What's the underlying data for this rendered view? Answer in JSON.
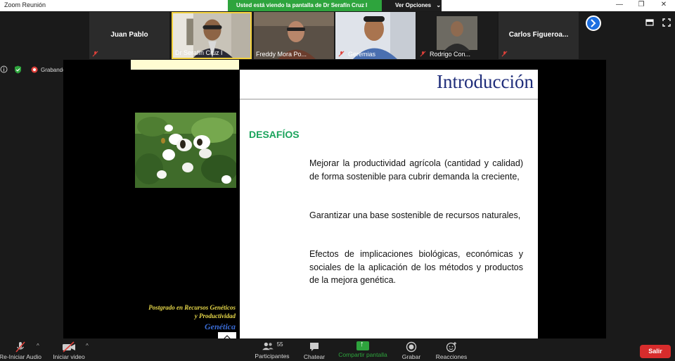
{
  "window": {
    "title": "Zoom Reunión",
    "minimize": "—",
    "restore": "❐",
    "close": "✕"
  },
  "share_banner": {
    "text": "Usted está viendo la pantalla de Dr Serafín Cruz I",
    "view_options": "Ver Opciones",
    "view_options_caret": "⌄"
  },
  "participants": [
    {
      "name": "Juan Pablo",
      "type": "name-only"
    },
    {
      "name": "Dr Serafín Cruz I",
      "type": "video"
    },
    {
      "name": "Freddy Mora Po...",
      "type": "video"
    },
    {
      "name": "Geremias",
      "type": "video"
    },
    {
      "name": "Rodrigo Con...",
      "type": "video"
    },
    {
      "name": "Carlos  Figueroa...",
      "type": "name-only"
    }
  ],
  "recording": {
    "label": "Grabando"
  },
  "slide": {
    "title": "Introducción",
    "heading": "DESAFÍOS",
    "paragraphs": [
      "Mejorar la productividad agrícola (cantidad y calidad) de forma sostenible para cubrir demanda la creciente,",
      "Garantizar una base sostenible de recursos naturales,",
      "Efectos de implicaciones biológicas, económicas y sociales de la aplicación de los métodos y productos de la mejora genética."
    ],
    "left_text_1": "Postgrado en Recursos Genéticos",
    "left_text_2": "y Productividad",
    "left_text_3": "Genética"
  },
  "toolbar": {
    "audio": "Re-Iniciar Audio",
    "video": "Iniciar video",
    "participants": "Participantes",
    "participants_count": "55",
    "chat": "Chatear",
    "share": "Compartir pantalla",
    "record": "Grabar",
    "reactions": "Reacciones",
    "leave": "Salir",
    "caret": "^"
  },
  "colors": {
    "share_green": "#2ea43d",
    "leave_red": "#d72c2c",
    "slide_title_blue": "#1f2d7a",
    "heading_green": "#1aa35b"
  }
}
